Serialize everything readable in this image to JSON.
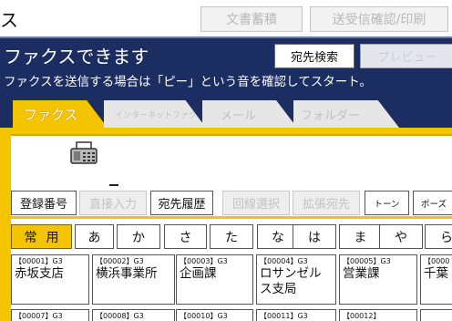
{
  "topbar": {
    "partial_char": "ス",
    "doc_store": "文書蓄積",
    "tx_status": "送受信確認/印刷"
  },
  "header": {
    "title": "ファクスできます",
    "subtitle": "ファクスを送信する場合は「ピー」という音を確認してスタート。",
    "dest_search": "宛先検索",
    "preview": "プレビュー"
  },
  "tabs": [
    {
      "label": "ファクス",
      "active": true
    },
    {
      "label": "インターネットファクス",
      "active": false
    },
    {
      "label": "メール",
      "active": false
    },
    {
      "label": "フォルダー",
      "active": false
    }
  ],
  "icons": {
    "fax": "fax-machine-icon"
  },
  "functions": {
    "reg_number": "登録番号",
    "direct_input": "直接入力",
    "history": "宛先履歴",
    "multi_select": "回線選択",
    "ext_dest": "拡張宛先",
    "tone": "トーン",
    "pause": "ポーズ"
  },
  "index": [
    "常用",
    "あ",
    "か",
    "さ",
    "た",
    "な",
    "は",
    "ま",
    "や",
    "ら"
  ],
  "destinations": [
    {
      "num": "【00001】G3",
      "name": "赤坂支店"
    },
    {
      "num": "【00002】G3",
      "name": "横浜事業所"
    },
    {
      "num": "【00003】G3",
      "name": "企画課"
    },
    {
      "num": "【00004】G3",
      "name": "ロサンゼルス支局"
    },
    {
      "num": "【00005】G3",
      "name": "営業課"
    },
    {
      "num": "【0000",
      "name": "千葉"
    }
  ],
  "destinations_row2": [
    "【00007】G3",
    "【00008】G3",
    "【00010】G3",
    "【00011】G3",
    "【00012】",
    ""
  ],
  "colors": {
    "accent": "#f5c400",
    "header_bg": "#1b2d61"
  }
}
